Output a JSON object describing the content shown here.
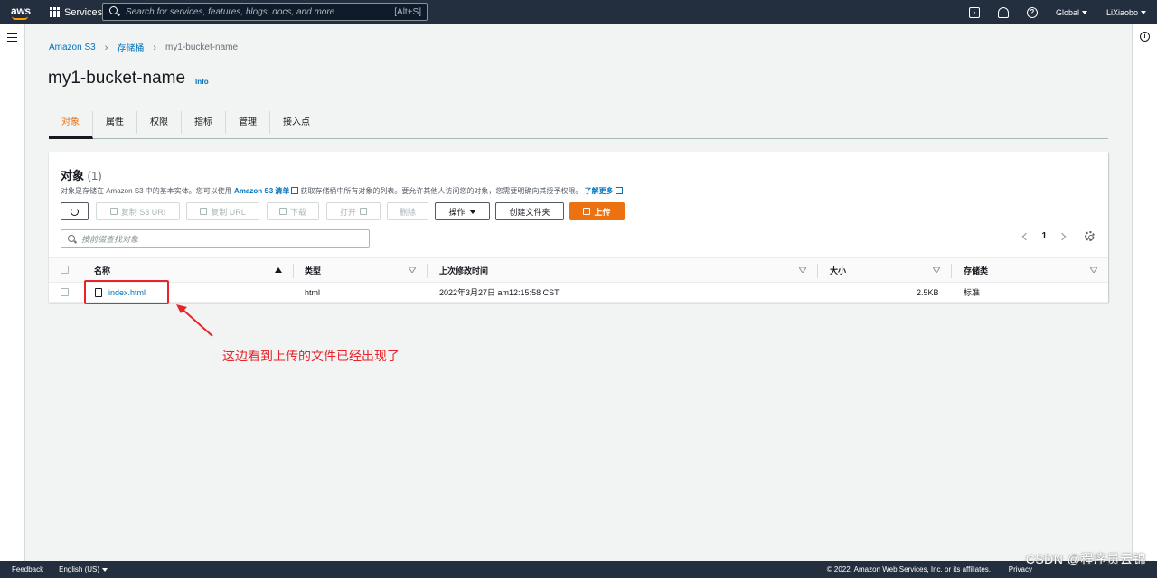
{
  "topbar": {
    "logo": "aws",
    "services_label": "Services",
    "search_placeholder": "Search for services, features, blogs, docs, and more",
    "search_shortcut": "[Alt+S]",
    "region": "Global",
    "user": "LiXiaobo",
    "icons": [
      "grid-icon",
      "search-icon",
      "cloudshell-icon",
      "bell-icon",
      "help-icon"
    ]
  },
  "breadcrumb": {
    "items": [
      "Amazon S3",
      "存储桶",
      "my1-bucket-name"
    ]
  },
  "page": {
    "title": "my1-bucket-name",
    "info_link": "Info"
  },
  "tabs": [
    {
      "label": "对象",
      "active": true
    },
    {
      "label": "属性"
    },
    {
      "label": "权限"
    },
    {
      "label": "指标"
    },
    {
      "label": "管理"
    },
    {
      "label": "接入点"
    }
  ],
  "objects_panel": {
    "title": "对象",
    "count": "(1)",
    "desc_prefix": "对象是存储在 Amazon S3 中的基本实体。您可以使用",
    "desc_link": "Amazon S3 清单",
    "desc_middle": "获取存储桶中所有对象的列表。要允许其他人访问您的对象，您需要明确向其授予权限。",
    "desc_learn_more": "了解更多",
    "buttons": {
      "copy_s3_uri": "复制 S3 URI",
      "copy_url": "复制 URL",
      "download": "下载",
      "open": "打开",
      "delete": "删除",
      "actions": "操作",
      "create_folder": "创建文件夹",
      "upload": "上传"
    },
    "filter_placeholder": "按前缀查找对象",
    "page_number": "1",
    "columns": [
      "名称",
      "类型",
      "上次修改时间",
      "大小",
      "存储类"
    ],
    "rows": [
      {
        "name": "index.html",
        "type": "html",
        "last_modified": "2022年3月27日 am12:15:58 CST",
        "size": "2.5KB",
        "storage_class": "标准"
      }
    ]
  },
  "annotation": {
    "text": "这边看到上传的文件已经出现了",
    "color": "#e8242a"
  },
  "footer": {
    "feedback": "Feedback",
    "language": "English (US)",
    "copyright": "© 2022, Amazon Web Services, Inc. or its affiliates.",
    "privacy": "Privacy"
  },
  "watermark": "CSDN @程序员云锦",
  "colors": {
    "topbar_bg": "#232f3e",
    "accent_orange": "#ec7211",
    "link_blue": "#0073bb"
  }
}
